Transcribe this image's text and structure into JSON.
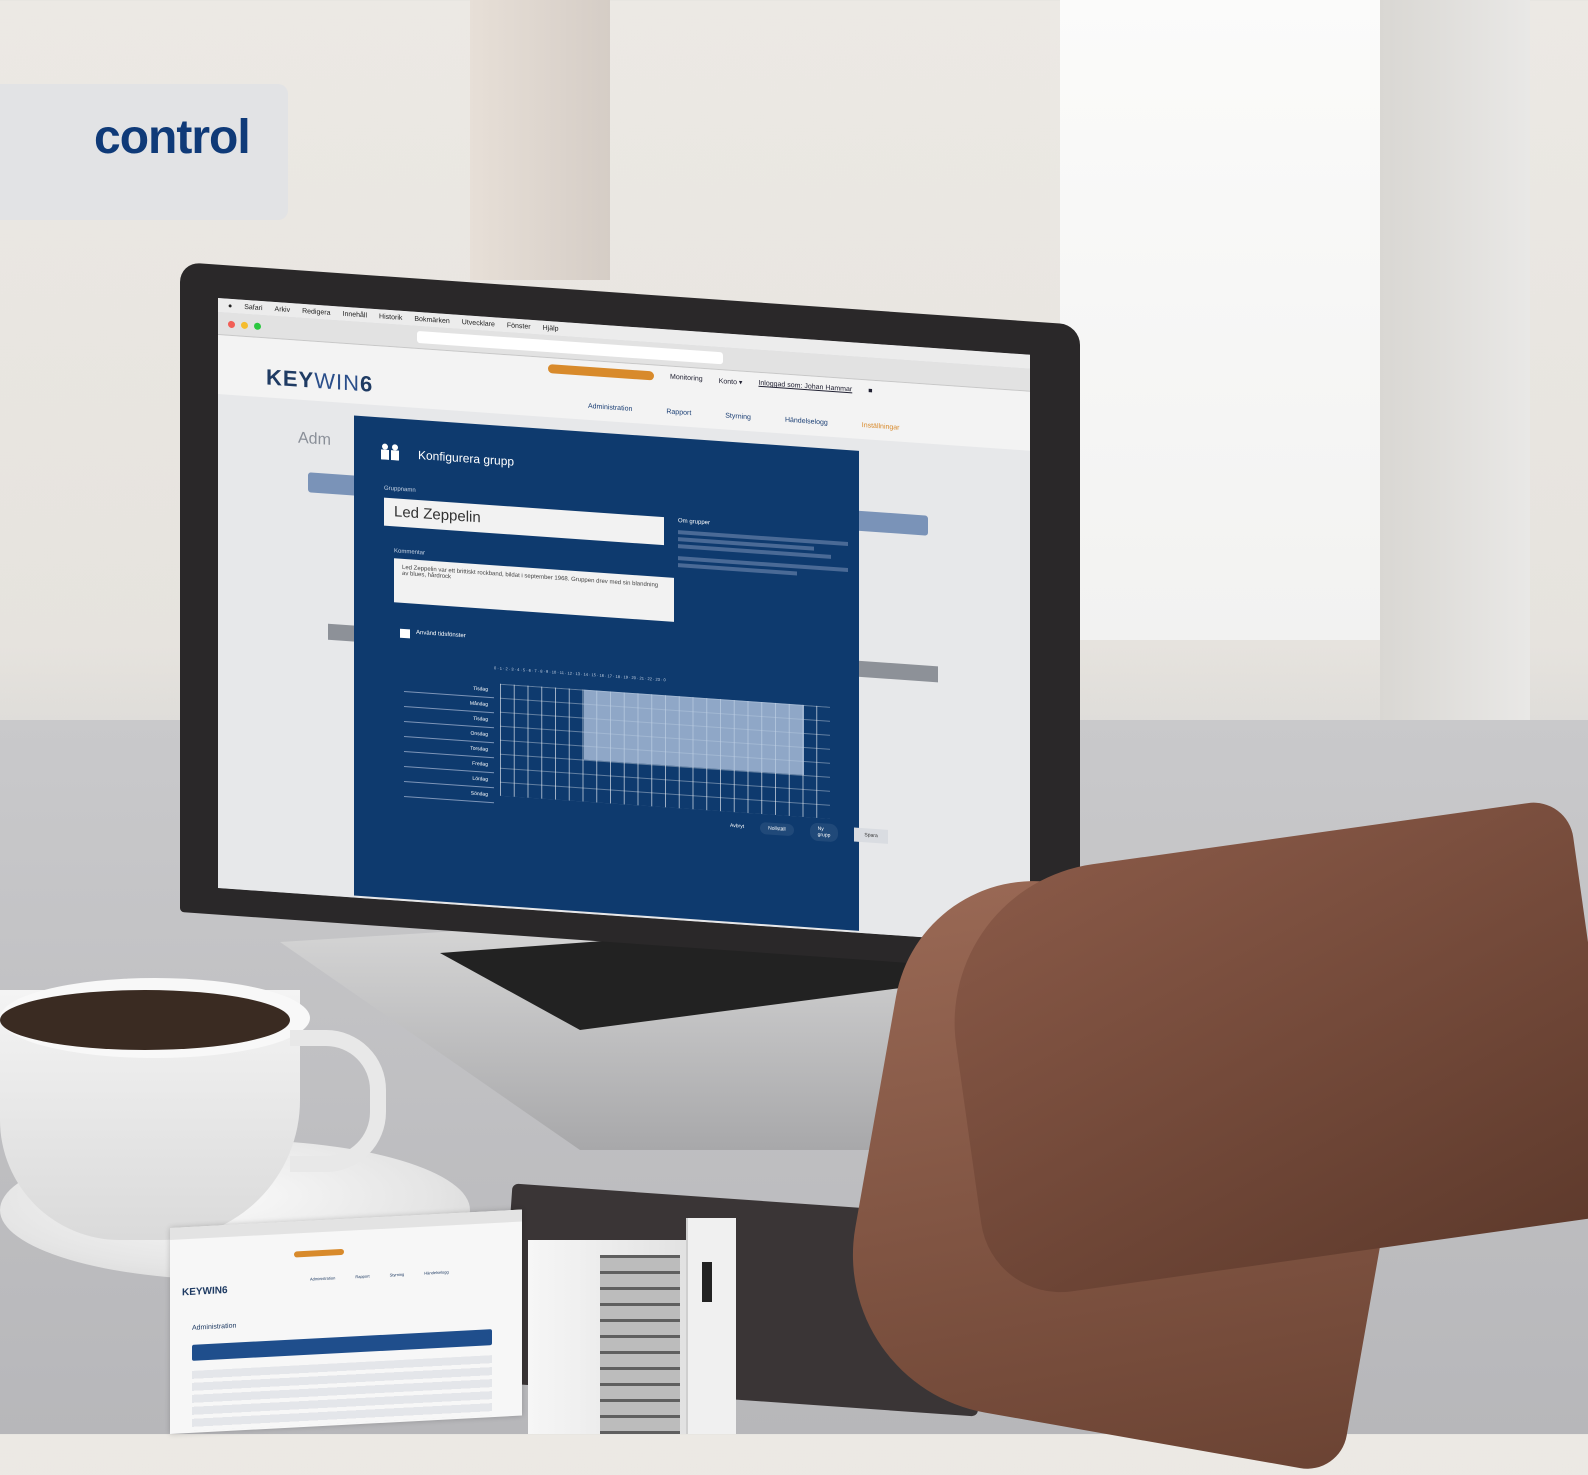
{
  "brand": {
    "label": "control"
  },
  "menubar": {
    "items": [
      "Safari",
      "Arkiv",
      "Redigera",
      "Innehåll",
      "Historik",
      "Bokmärken",
      "Utvecklare",
      "Fönster",
      "Hjälp"
    ]
  },
  "app": {
    "logo_bold": "KEY",
    "logo_thin": "WIN",
    "logo_num": "6",
    "top_links": {
      "monitoring": "Monitoring",
      "account": "Konto ▾",
      "logout": "Inloggad som: Johan Hammar"
    },
    "nav": [
      "Administration",
      "Rapport",
      "Styrning",
      "Händelselogg",
      "Inställningar"
    ],
    "nav_active": "Inställningar",
    "page_title": "Adm"
  },
  "modal": {
    "title": "Konfigurera grupp",
    "group_name_label": "Gruppnamn",
    "group_name": "Led Zeppelin",
    "comments_label": "Kommentar",
    "comment": "Led Zeppelin var ett brittiskt rockband, bildat i september 1968. Gruppen drev med sin blandning av blues, hårdrock",
    "about_title": "Om grupper",
    "use_time_windows": "Använd tidsfönster",
    "days": [
      "Tisdag",
      "Måndag",
      "Tisdag",
      "Onsdag",
      "Torsdag",
      "Fredag",
      "Lördag",
      "Söndag"
    ],
    "hours": "0 · 1 · 2 · 3 · 4 · 5 · 6 · 7 · 8 · 9 · 10 · 11 · 12 · 13 · 14 · 15 · 16 · 17 · 18 · 19 · 20 · 21 · 22 · 23 · 0",
    "cancel": "Avbryt",
    "update": "Nollställ",
    "new_group": "Ny grupp",
    "save": "Spara"
  },
  "mini_screenshot": {
    "logo": "KEYWIN6",
    "title": "Administration"
  },
  "colors": {
    "brand": "#0f3a78",
    "modal_bg": "#0e3a6e",
    "accent": "#d88a2b"
  }
}
